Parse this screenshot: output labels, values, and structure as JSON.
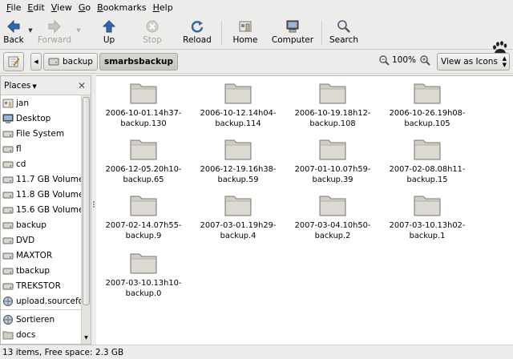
{
  "menubar": {
    "items": [
      "File",
      "Edit",
      "View",
      "Go",
      "Bookmarks",
      "Help"
    ]
  },
  "toolbar": {
    "back_label": "Back",
    "forward_label": "Forward",
    "up_label": "Up",
    "stop_label": "Stop",
    "reload_label": "Reload",
    "home_label": "Home",
    "computer_label": "Computer",
    "search_label": "Search"
  },
  "location": {
    "crumbs": [
      "backup",
      "smarbsbackup"
    ],
    "zoom": "100%",
    "view_mode": "View as Icons"
  },
  "sidebar": {
    "title": "Places",
    "items": [
      {
        "label": "jan",
        "icon": "home-icon"
      },
      {
        "label": "Desktop",
        "icon": "desktop-icon"
      },
      {
        "label": "File System",
        "icon": "drive-icon"
      },
      {
        "label": "fl",
        "icon": "drive-icon"
      },
      {
        "label": "cd",
        "icon": "drive-icon"
      },
      {
        "label": "11.7 GB Volume",
        "icon": "drive-icon"
      },
      {
        "label": "11.8 GB Volume",
        "icon": "drive-icon"
      },
      {
        "label": "15.6 GB Volume",
        "icon": "drive-icon"
      },
      {
        "label": "backup",
        "icon": "drive-icon"
      },
      {
        "label": "DVD",
        "icon": "drive-icon"
      },
      {
        "label": "MAXTOR",
        "icon": "drive-icon"
      },
      {
        "label": "tbackup",
        "icon": "drive-icon"
      },
      {
        "label": "TREKSTOR",
        "icon": "drive-icon"
      },
      {
        "label": "upload.sourcefor",
        "icon": "network-icon"
      }
    ],
    "bookmarks": [
      {
        "label": "Sortieren",
        "icon": "network-icon"
      },
      {
        "label": "docs",
        "icon": "folder-icon"
      }
    ]
  },
  "files": [
    "2006-10-01.14h37-\nbackup.130",
    "2006-10-12.14h04-\nbackup.114",
    "2006-10-19.18h12-\nbackup.108",
    "2006-10-26.19h08-\nbackup.105",
    "2006-12-05.20h10-\nbackup.65",
    "2006-12-19.16h38-\nbackup.59",
    "2007-01-10.07h59-\nbackup.39",
    "2007-02-08.08h11-\nbackup.15",
    "2007-02-14.07h55-\nbackup.9",
    "2007-03-01.19h29-\nbackup.4",
    "2007-03-04.10h50-\nbackup.2",
    "2007-03-10.13h02-\nbackup.1",
    "2007-03-10.13h10-\nbackup.0"
  ],
  "status": "13 items, Free space: 2.3 GB",
  "colors": {
    "window_bg": "#edeceb",
    "folder_fill": "#cfcdc4",
    "folder_stroke": "#7d7b74",
    "accent_blue": "#3465a4"
  }
}
